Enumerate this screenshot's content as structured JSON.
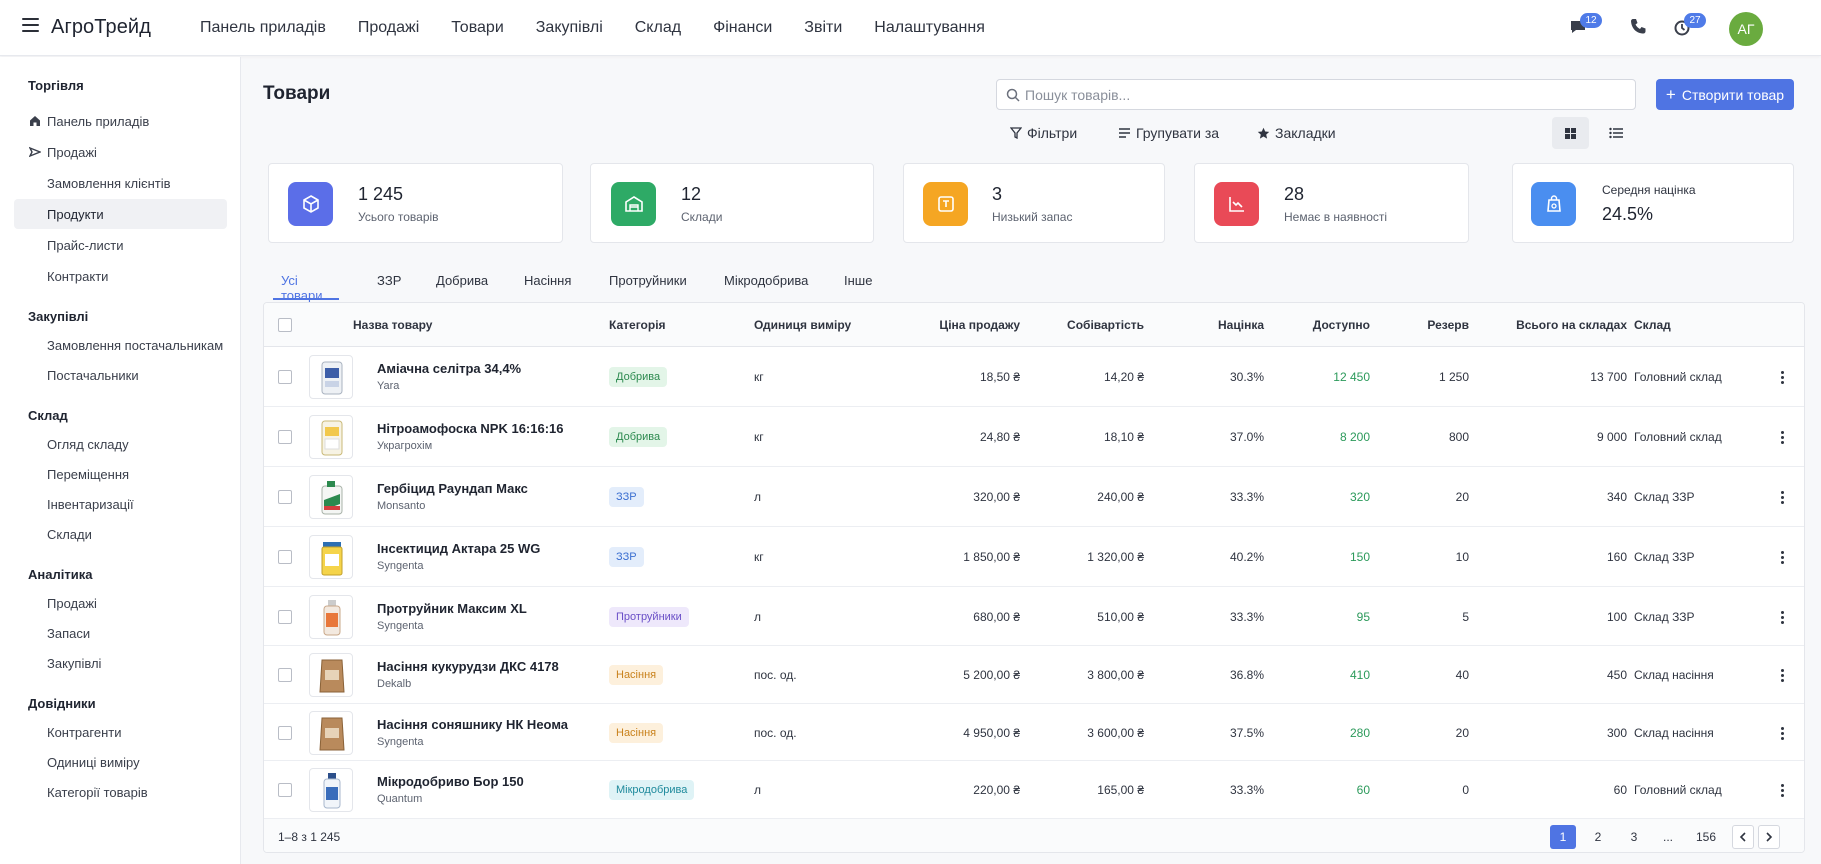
{
  "app": {
    "brand": "АгроТрейд",
    "nav": [
      "Панель приладів",
      "Продажі",
      "Товари",
      "Закупівлі",
      "Склад",
      "Фінанси",
      "Звіти",
      "Налаштування"
    ],
    "messages_badge": "12",
    "notifications_badge": "27",
    "avatar_initials": "АГ",
    "accent_color": "#4f74e3"
  },
  "sidebar": {
    "sections": [
      {
        "title": "Торгівля",
        "items": [
          {
            "label": "Панель приладів",
            "icon": "home-icon"
          },
          {
            "label": "Продажі",
            "icon": "send-icon"
          },
          {
            "label": "Замовлення клієнтів"
          },
          {
            "label": "Продукти",
            "active": true
          },
          {
            "label": "Прайс-листи"
          },
          {
            "label": "Контракти"
          }
        ]
      },
      {
        "title": "Закупівлі",
        "items": [
          {
            "label": "Замовлення постачальникам"
          },
          {
            "label": "Постачальники"
          }
        ]
      },
      {
        "title": "Склад",
        "items": [
          {
            "label": "Огляд складу"
          },
          {
            "label": "Переміщення"
          },
          {
            "label": "Інвентаризації"
          },
          {
            "label": "Склади"
          }
        ]
      },
      {
        "title": "Аналітика",
        "items": [
          {
            "label": "Продажі"
          },
          {
            "label": "Запаси"
          },
          {
            "label": "Закупівлі"
          }
        ]
      },
      {
        "title": "Довідники",
        "items": [
          {
            "label": "Контрагенти"
          },
          {
            "label": "Одиниці виміру"
          },
          {
            "label": "Категорії товарів"
          }
        ]
      }
    ]
  },
  "main": {
    "title": "Товари",
    "search_placeholder": "Пошук товарів...",
    "create_label": "Створити товар",
    "filters_label": "Фільтри",
    "group_label": "Групувати за",
    "bookmarks_label": "Закладки"
  },
  "stats": [
    {
      "value": "1 245",
      "label": "Усього товарів",
      "color": "#5b6ee8",
      "icon": "cube-icon"
    },
    {
      "value": "12",
      "label": "Склади",
      "color": "#2eaa66",
      "icon": "warehouse-icon"
    },
    {
      "value": "3",
      "label": "Низький запас",
      "color": "#f5a623",
      "icon": "box-icon"
    },
    {
      "value": "28",
      "label": "Немає в наявності",
      "color": "#e94a57",
      "icon": "chart-down-icon"
    },
    {
      "value": "24.5%",
      "label": "Середня націнка",
      "color": "#4a8ef0",
      "icon": "percent-bag-icon"
    }
  ],
  "tabs": [
    "Усі товари",
    "ЗЗР",
    "Добрива",
    "Насіння",
    "Протруйники",
    "Мікродобрива",
    "Інше"
  ],
  "table": {
    "columns": [
      "Назва товару",
      "Категорія",
      "Одиниця виміру",
      "Ціна продажу",
      "Собівартість",
      "Націнка",
      "Доступно",
      "Резерв",
      "Всього на складах",
      "Склад"
    ],
    "rows": [
      {
        "name": "Аміачна селітра 34,4%",
        "brand": "Yara",
        "category": "Добрива",
        "unit": "кг",
        "price": "18,50 ₴",
        "cost": "14,20 ₴",
        "margin": "30.3%",
        "available": "12 450",
        "reserve": "1 250",
        "total": "13 700",
        "warehouse": "Головний склад",
        "thumb": "bag-blue"
      },
      {
        "name": "Нітроамофоска NPK 16:16:16",
        "brand": "Украгрохім",
        "category": "Добрива",
        "unit": "кг",
        "price": "24,80 ₴",
        "cost": "18,10 ₴",
        "margin": "37.0%",
        "available": "8 200",
        "reserve": "800",
        "total": "9 000",
        "warehouse": "Головний склад",
        "thumb": "bag-yellow"
      },
      {
        "name": "Гербіцид Раундап Макс",
        "brand": "Monsanto",
        "category": "ЗЗР",
        "unit": "л",
        "price": "320,00 ₴",
        "cost": "240,00 ₴",
        "margin": "33.3%",
        "available": "320",
        "reserve": "20",
        "total": "340",
        "warehouse": "Склад ЗЗР",
        "thumb": "can-green"
      },
      {
        "name": "Інсектицид Актара 25 WG",
        "brand": "Syngenta",
        "category": "ЗЗР",
        "unit": "кг",
        "price": "1 850,00 ₴",
        "cost": "1 320,00 ₴",
        "margin": "40.2%",
        "available": "150",
        "reserve": "10",
        "total": "160",
        "warehouse": "Склад ЗЗР",
        "thumb": "jar-yellow"
      },
      {
        "name": "Протруйник Максим XL",
        "brand": "Syngenta",
        "category": "Протруйники",
        "unit": "л",
        "price": "680,00 ₴",
        "cost": "510,00 ₴",
        "margin": "33.3%",
        "available": "95",
        "reserve": "5",
        "total": "100",
        "warehouse": "Склад ЗЗР",
        "thumb": "bottle-orange"
      },
      {
        "name": "Насіння кукурудзи ДКС 4178",
        "brand": "Dekalb",
        "category": "Насіння",
        "unit": "пос. од.",
        "price": "5 200,00 ₴",
        "cost": "3 800,00 ₴",
        "margin": "36.8%",
        "available": "410",
        "reserve": "40",
        "total": "450",
        "warehouse": "Склад насіння",
        "thumb": "sack-brown"
      },
      {
        "name": "Насіння соняшнику НК Неома",
        "brand": "Syngenta",
        "category": "Насіння",
        "unit": "пос. од.",
        "price": "4 950,00 ₴",
        "cost": "3 600,00 ₴",
        "margin": "37.5%",
        "available": "280",
        "reserve": "20",
        "total": "300",
        "warehouse": "Склад насіння",
        "thumb": "sack-brown"
      },
      {
        "name": "Мікродобриво Бор 150",
        "brand": "Quantum",
        "category": "Мікродобрива",
        "unit": "л",
        "price": "220,00 ₴",
        "cost": "165,00 ₴",
        "margin": "33.3%",
        "available": "60",
        "reserve": "0",
        "total": "60",
        "warehouse": "Головний склад",
        "thumb": "bottle-blue"
      }
    ]
  },
  "category_colors": {
    "Добрива": {
      "bg": "#e3f5e8",
      "fg": "#2c8a4f"
    },
    "ЗЗР": {
      "bg": "#e3edfb",
      "fg": "#3b6fd1"
    },
    "Протруйники": {
      "bg": "#eee8fb",
      "fg": "#6a4fc7"
    },
    "Насіння": {
      "bg": "#fdf0dc",
      "fg": "#c9821c"
    },
    "Мікродобрива": {
      "bg": "#dff3f6",
      "fg": "#1f8a9c"
    }
  },
  "pagination": {
    "summary": "1–8 з 1 245",
    "pages": [
      "1",
      "2",
      "3",
      "...",
      "156"
    ]
  }
}
